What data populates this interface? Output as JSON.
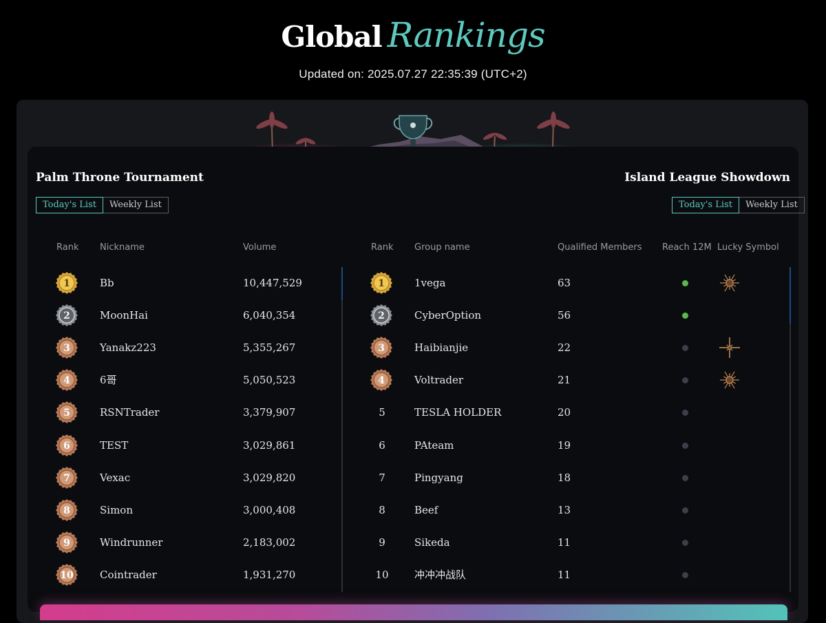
{
  "header": {
    "title_main": "Global",
    "title_accent": "Rankings",
    "updated": "Updated on: 2025.07.27 22:35:39 (UTC+2)"
  },
  "colors": {
    "accent": "#5ec9bf",
    "gold": "#d9a93a",
    "silver": "#8c8f94",
    "bronze": "#b97a56",
    "online": "#5cb84d",
    "offline": "#3a3f4a"
  },
  "left": {
    "title": "Palm Throne Tournament",
    "tabs": [
      {
        "label": "Today's List",
        "active": true
      },
      {
        "label": "Weekly List",
        "active": false
      }
    ],
    "columns": {
      "rank": "Rank",
      "nickname": "Nickname",
      "volume": "Volume"
    },
    "rows": [
      {
        "rank": "1",
        "medal": "gold",
        "nickname": "Bb",
        "volume": "10,447,529"
      },
      {
        "rank": "2",
        "medal": "silver",
        "nickname": "MoonHai",
        "volume": "6,040,354"
      },
      {
        "rank": "3",
        "medal": "bronze",
        "nickname": "Yanakz223",
        "volume": "5,355,267"
      },
      {
        "rank": "4",
        "medal": "bronze",
        "nickname": "6哥",
        "volume": "5,050,523"
      },
      {
        "rank": "5",
        "medal": "bronze",
        "nickname": "RSNTrader",
        "volume": "3,379,907"
      },
      {
        "rank": "6",
        "medal": "bronze",
        "nickname": "TEST",
        "volume": "3,029,861"
      },
      {
        "rank": "7",
        "medal": "bronze",
        "nickname": "Vexac",
        "volume": "3,029,820"
      },
      {
        "rank": "8",
        "medal": "bronze",
        "nickname": "Simon",
        "volume": "3,000,408"
      },
      {
        "rank": "9",
        "medal": "bronze",
        "nickname": "Windrunner",
        "volume": "2,183,002"
      },
      {
        "rank": "10",
        "medal": "bronze",
        "nickname": "Cointrader",
        "volume": "1,931,270"
      }
    ]
  },
  "right": {
    "title": "Island League Showdown",
    "tabs": [
      {
        "label": "Today's List",
        "active": true
      },
      {
        "label": "Weekly List",
        "active": false
      }
    ],
    "columns": {
      "rank": "Rank",
      "group": "Group name",
      "members": "Qualified Members",
      "reach": "Reach 12M",
      "lucky": "Lucky Symbol"
    },
    "rows": [
      {
        "rank": "1",
        "medal": "gold",
        "group": "1vega",
        "members": "63",
        "reach": true,
        "lucky": "sun-burst-icon"
      },
      {
        "rank": "2",
        "medal": "silver",
        "group": "CyberOption",
        "members": "56",
        "reach": true,
        "lucky": ""
      },
      {
        "rank": "3",
        "medal": "bronze",
        "group": "Haibianjie",
        "members": "22",
        "reach": false,
        "lucky": "star-burst-icon"
      },
      {
        "rank": "4",
        "medal": "bronze",
        "group": "Voltrader",
        "members": "21",
        "reach": false,
        "lucky": "sun-burst-icon"
      },
      {
        "rank": "5",
        "medal": "",
        "group": "TESLA HOLDER",
        "members": "20",
        "reach": false,
        "lucky": ""
      },
      {
        "rank": "6",
        "medal": "",
        "group": "PAteam",
        "members": "19",
        "reach": false,
        "lucky": ""
      },
      {
        "rank": "7",
        "medal": "",
        "group": "Pingyang",
        "members": "18",
        "reach": false,
        "lucky": ""
      },
      {
        "rank": "8",
        "medal": "",
        "group": "Beef",
        "members": "13",
        "reach": false,
        "lucky": ""
      },
      {
        "rank": "9",
        "medal": "",
        "group": "Sikeda",
        "members": "11",
        "reach": false,
        "lucky": ""
      },
      {
        "rank": "10",
        "medal": "",
        "group": "冲冲冲战队",
        "members": "11",
        "reach": false,
        "lucky": ""
      }
    ]
  }
}
